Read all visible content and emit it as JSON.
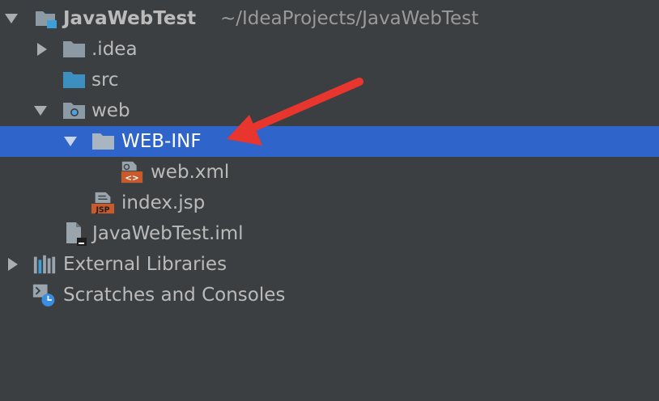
{
  "colors": {
    "background": "#3c3f41",
    "selection": "#2f65ca",
    "text": "#bbbbbb",
    "path_text": "#9a9a9a",
    "folder": "#8c9aa5",
    "source_folder": "#3d8fbf",
    "annotation_arrow": "#e8362f",
    "xml_badge": "#c85a2b",
    "jsp_badge": "#c85a2b",
    "clock": "#3a8ee0"
  },
  "tree": {
    "project": {
      "name": "JavaWebTest",
      "path": "~/IdeaProjects/JavaWebTest",
      "expanded": true
    },
    "idea": {
      "label": ".idea",
      "expanded": false
    },
    "src": {
      "label": "src"
    },
    "web": {
      "label": "web",
      "expanded": true
    },
    "web_inf": {
      "label": "WEB-INF",
      "expanded": true,
      "selected": true
    },
    "web_xml": {
      "label": "web.xml",
      "badge": "<>"
    },
    "index_jsp": {
      "label": "index.jsp",
      "badge": "JSP"
    },
    "iml": {
      "label": "JavaWebTest.iml"
    },
    "external_libraries": {
      "label": "External Libraries",
      "expanded": false
    },
    "scratches": {
      "label": "Scratches and Consoles"
    }
  },
  "annotation": {
    "type": "arrow",
    "points_to": "WEB-INF"
  }
}
